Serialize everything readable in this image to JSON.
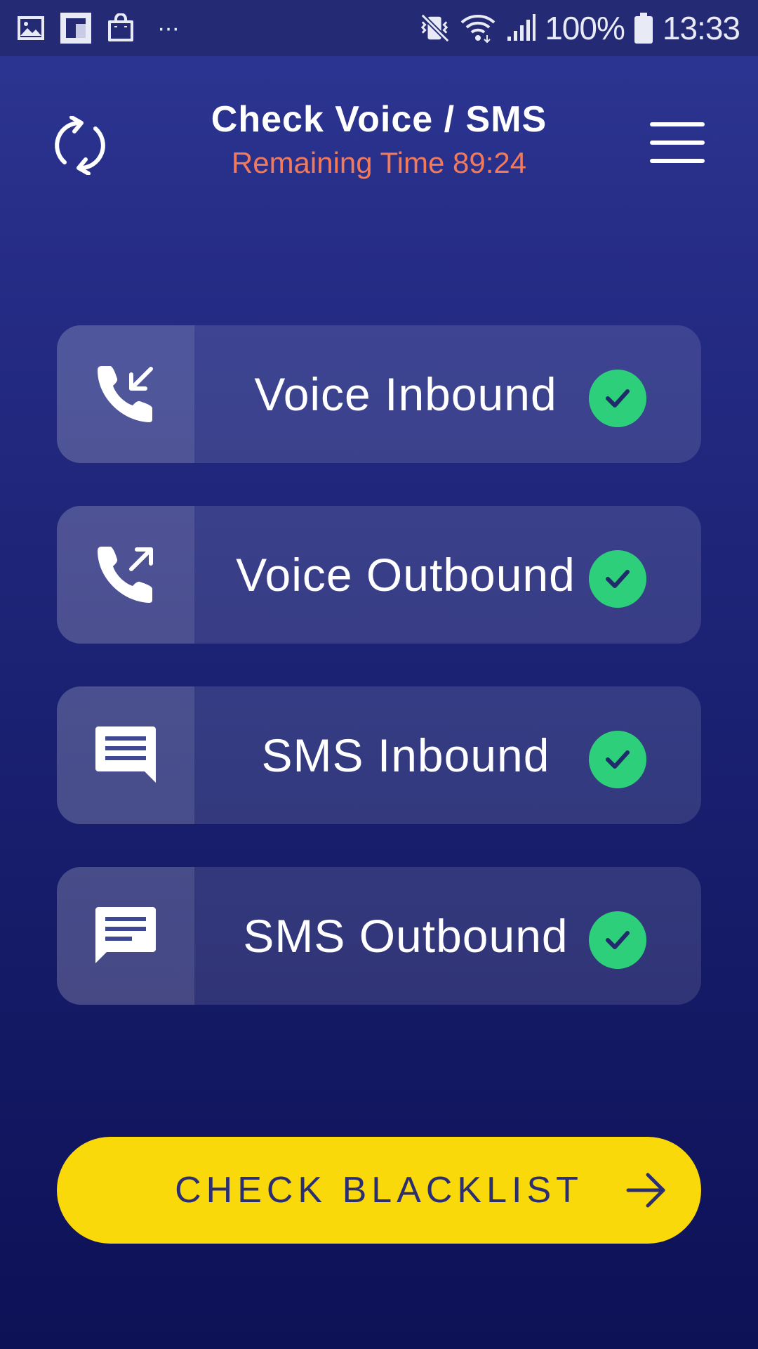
{
  "status_bar": {
    "battery_pct": "100%",
    "time": "13:33",
    "overflow": "···",
    "icons": [
      "gallery-icon",
      "flipboard-icon",
      "shopping-bag-icon",
      "mute-icon",
      "wifi-icon",
      "signal-icon",
      "battery-icon"
    ]
  },
  "header": {
    "title": "Check Voice / SMS",
    "subtitle": "Remaining Time 89:24",
    "refresh_icon": "refresh-icon",
    "menu_icon": "hamburger-menu-icon",
    "subtitle_color": "#f07a5a"
  },
  "checks": [
    {
      "label": "Voice Inbound",
      "icon": "phone-incoming-icon",
      "status": "passed"
    },
    {
      "label": "Voice Outbound",
      "icon": "phone-outgoing-icon",
      "status": "passed"
    },
    {
      "label": "SMS Inbound",
      "icon": "message-inbound-icon",
      "status": "passed"
    },
    {
      "label": "SMS Outbound",
      "icon": "message-outbound-icon",
      "status": "passed"
    }
  ],
  "cta": {
    "label": "CHECK BLACKLIST",
    "icon": "arrow-right-icon",
    "color": "#f9d90a"
  },
  "colors": {
    "background_top": "#2d3794",
    "background_bottom": "#0d1156",
    "check_green": "#2ecf7a"
  }
}
